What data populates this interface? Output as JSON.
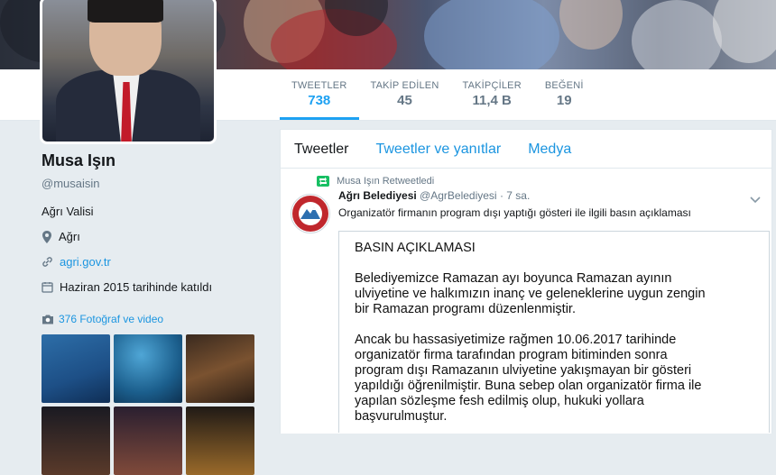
{
  "stats": [
    {
      "label": "TWEETLER",
      "value": "738"
    },
    {
      "label": "TAKİP EDİLEN",
      "value": "45"
    },
    {
      "label": "TAKİPÇİLER",
      "value": "11,4 B"
    },
    {
      "label": "BEĞENİ",
      "value": "19"
    }
  ],
  "profile": {
    "name": "Musa Işın",
    "handle": "@musaisin",
    "bio": "Ağrı Valisi",
    "location": "Ağrı",
    "website": "agri.gov.tr",
    "joined": "Haziran 2015 tarihinde katıldı",
    "photos_link": "376 Fotoğraf ve video"
  },
  "tabs": [
    "Tweetler",
    "Tweetler ve yanıtlar",
    "Medya"
  ],
  "tweet": {
    "retweet_note": "Musa Işın Retweetledi",
    "author_name": "Ağrı Belediyesi",
    "author_handle": "@AgrBelediyesi",
    "time": "· 7 sa.",
    "text": "Organizatör firmanın program dışı yaptığı gösteri ile ilgili basın açıklaması"
  },
  "press_release": {
    "title": "BASIN AÇIKLAMASI",
    "p1_l1": "Belediyemizce Ramazan ayı boyunca Ramazan ayının",
    "p1_l2": "ulviyetine ve halkımızın inanç  ve geleneklerine uygun zengin",
    "p1_l3": "bir Ramazan programı düzenlenmiştir.",
    "p2_l1": "Ancak bu hassasiyetimize rağmen 10.06.2017 tarihinde",
    "p2_l2": "organizatör firma tarafından program bitiminden sonra",
    "p2_l3": "program dışı Ramazanın ulviyetine yakışmayan bir gösteri",
    "p2_l4": "yapıldığı öğrenilmiştir. Buna sebep olan organizatör firma ile",
    "p2_l5": "yapılan sözleşme fesh edilmiş olup, hukuki yollara",
    "p2_l6": "başvurulmuştur."
  },
  "colors": {
    "accent": "#1da1f2",
    "link": "#1b95e0",
    "muted": "#657786",
    "background": "#e6ecf0"
  }
}
